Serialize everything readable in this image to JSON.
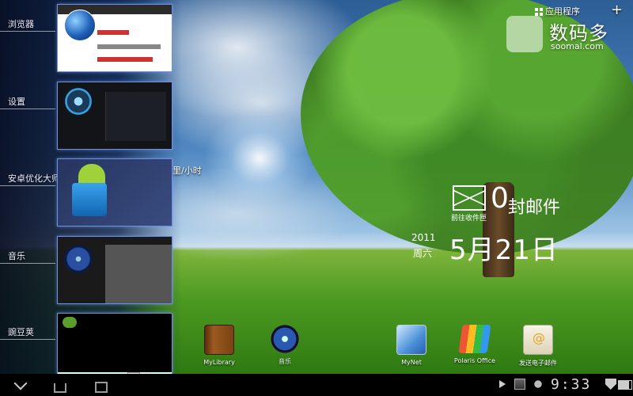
{
  "recent_apps": [
    {
      "label": "浏览器"
    },
    {
      "label": "设置"
    },
    {
      "label": "安卓优化大师"
    },
    {
      "label": "音乐"
    },
    {
      "label": "豌豆荚"
    }
  ],
  "peek_text": "里/小时",
  "top_right": {
    "app_drawer_label": "应用程序",
    "watermark_title": "数码多",
    "watermark_sub": "soomal.com"
  },
  "email_widget": {
    "caption": "前往收件匣",
    "count": "0",
    "suffix": "封邮件"
  },
  "clock_widget": {
    "year": "2011",
    "weekday": "周六",
    "date": "5月21日"
  },
  "dock": [
    {
      "label": "MyLibrary",
      "icon": "book-icon"
    },
    {
      "label": "音乐",
      "icon": "music-icon"
    },
    {
      "label": "MyNet",
      "icon": "mynet-icon"
    },
    {
      "label": "Polaris Office",
      "icon": "polaris-office-icon"
    },
    {
      "label": "发送电子邮件",
      "icon": "email-app-icon"
    }
  ],
  "status_bar": {
    "time": "9:33"
  }
}
